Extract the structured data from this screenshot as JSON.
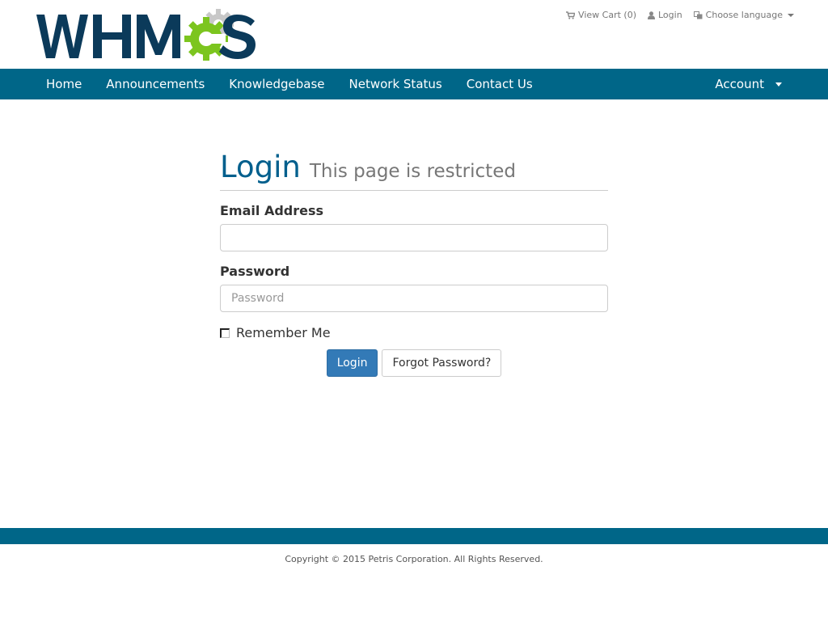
{
  "brand": {
    "logo_text": "WHMCS",
    "colors": {
      "navy": "#0b3a5a",
      "green": "#7cc51f",
      "gray_gear": "#c8c8c8",
      "nav_bg": "#006688",
      "title_blue": "#005f8d",
      "button_blue": "#337ab7"
    }
  },
  "top_links": {
    "cart": {
      "icon": "cart-icon",
      "label": "View Cart (0)"
    },
    "login": {
      "icon": "user-icon",
      "label": "Login"
    },
    "language": {
      "icon": "language-icon",
      "label": "Choose language"
    }
  },
  "nav": {
    "items": [
      {
        "label": "Home"
      },
      {
        "label": "Announcements"
      },
      {
        "label": "Knowledgebase"
      },
      {
        "label": "Network Status"
      },
      {
        "label": "Contact Us"
      }
    ],
    "account_label": "Account"
  },
  "login": {
    "title": "Login",
    "subtitle": "This page is restricted",
    "email_label": "Email Address",
    "email_value": "",
    "email_placeholder": "",
    "password_label": "Password",
    "password_placeholder": "Password",
    "remember_label": "Remember Me",
    "remember_checked": false,
    "login_button": "Login",
    "forgot_button": "Forgot Password?"
  },
  "footer": {
    "copyright": "Copyright © 2015 Petris Corporation. All Rights Reserved."
  }
}
